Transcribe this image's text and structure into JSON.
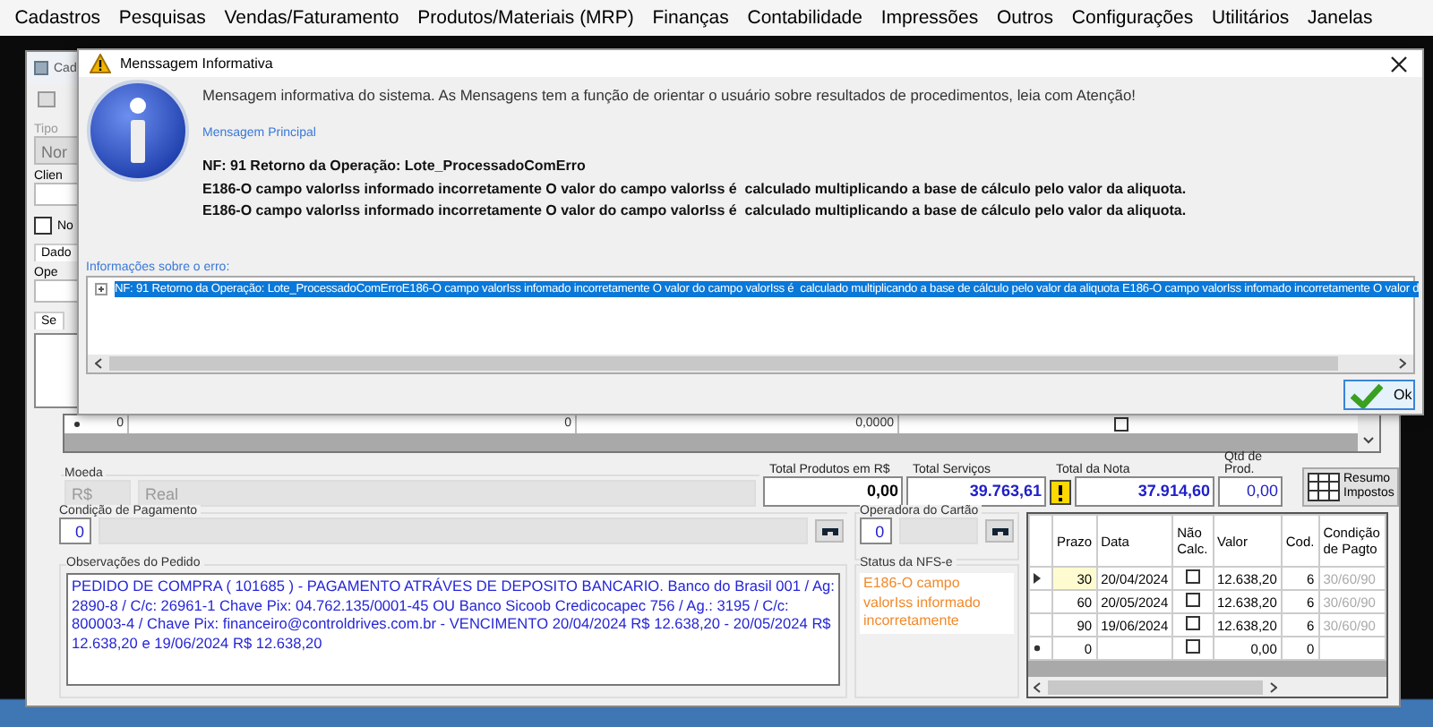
{
  "menu_bar": {
    "items": [
      "Cadastros",
      "Pesquisas",
      "Vendas/Faturamento",
      "Produtos/Materiais (MRP)",
      "Finanças",
      "Contabilidade",
      "Impressões",
      "Outros",
      "Configurações",
      "Utilitários",
      "Janelas"
    ]
  },
  "main_window": {
    "title": "Cad",
    "type_label": "Tipo",
    "type_value": "Nor",
    "client_label": "Clien",
    "notify_checkbox": {
      "label": "No",
      "checked": false
    },
    "tab_label": "Dado",
    "operation_label": "Ope",
    "subtab_label": "Se",
    "items_grid": {
      "cells": [
        "0",
        "0",
        "0,0000"
      ],
      "checked": false
    },
    "currency": {
      "label": "Moeda",
      "code": "R$",
      "name": "Real"
    },
    "totals": [
      {
        "label": "Total Produtos em R$",
        "value": "0,00",
        "kind": "plain"
      },
      {
        "label": "Total Serviços",
        "value": "39.763,61",
        "kind": "highlight"
      },
      {
        "label": "Total da Nota",
        "value": "37.914,60",
        "kind": "warning"
      },
      {
        "label": "Qtd de Prod.",
        "value": "0,00",
        "kind": "plain"
      }
    ],
    "tax_summary_button": "Resumo Impostos",
    "payment_condition": {
      "label": "Condição de Pagamento",
      "code": "0"
    },
    "card_operator": {
      "label": "Operadora do Cartão",
      "code": "0"
    },
    "notes": {
      "label": "Observações do Pedido",
      "text": "PEDIDO DE COMPRA ( 101685 ) - PAGAMENTO ATRÁVES DE DEPOSITO BANCARIO. Banco do Brasil 001 / Ag: 2890-8 / C/c: 26961-1 Chave Pix: 04.762.135/0001-45 OU Banco Sicoob Credicocapec 756 / Ag.: 3195 /  C/c: 800003-4 / Chave Pix: financeiro@controldrives.com.br - VENCIMENTO 20/04/2024 R$ 12.638,20 - 20/05/2024 R$ 12.638,20 e 19/06/2024 R$ 12.638,20"
    },
    "nfse_status": {
      "label": "Status da NFS-e",
      "text": "E186-O campo valorIss informado incorretamente"
    },
    "installments": {
      "columns": [
        "Prazo",
        "Data",
        "Não Calc.",
        "Valor",
        "Cod.",
        "Condição de Pagto"
      ],
      "rows": [
        {
          "current": true,
          "new": false,
          "checked": false,
          "cells": [
            "30",
            "20/04/2024",
            "",
            "12.638,20",
            "6",
            "30/60/90"
          ]
        },
        {
          "current": false,
          "new": false,
          "checked": false,
          "cells": [
            "60",
            "20/05/2024",
            "",
            "12.638,20",
            "6",
            "30/60/90"
          ]
        },
        {
          "current": false,
          "new": false,
          "checked": false,
          "cells": [
            "90",
            "19/06/2024",
            "",
            "12.638,20",
            "6",
            "30/60/90"
          ]
        },
        {
          "current": false,
          "new": true,
          "checked": false,
          "cells": [
            "0",
            "",
            "",
            "0,00",
            "0",
            ""
          ]
        }
      ]
    }
  },
  "dialog": {
    "title": "Menssagem Informativa",
    "message": "Mensagem informativa do sistema. As Mensagens tem a função de orientar o usuário sobre resultados de procedimentos, leia com Atenção!",
    "section_label": "Mensagem Principal",
    "main_lines": [
      "NF: 91 Retorno da Operação: Lote_ProcessadoComErro",
      "E186-O campo valorIss informado incorretamente O valor do campo valorIss é  calculado multiplicando a base de cálculo pelo valor da aliquota.",
      "E186-O campo valorIss informado incorretamente O valor do campo valorIss é  calculado multiplicando a base de cálculo pelo valor da aliquota."
    ],
    "details_label": "Informações sobre o erro:",
    "details_rows": [
      {
        "text": "NF: 91 Retorno da Operação: Lote_ProcessadoComErroE186-O campo valorIss infomado incorretamente O valor do campo valorIss é  calculado multiplicando a base de cálculo pelo valor da aliquota E186-O campo valorIss infomado incorretamente O valor d",
        "selected": true,
        "expanded": false
      }
    ],
    "ok_button": "Ok"
  }
}
